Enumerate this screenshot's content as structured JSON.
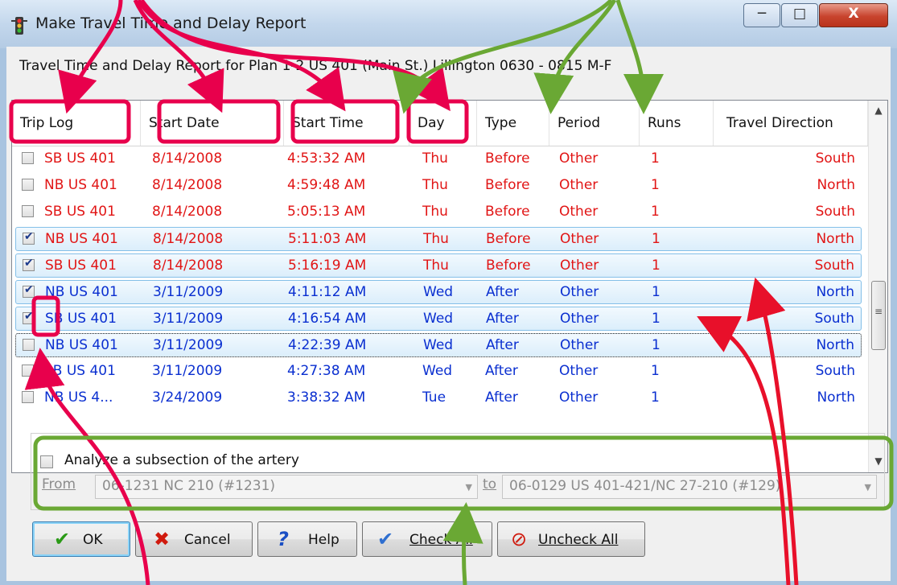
{
  "window": {
    "title": "Make Travel Time and Delay Report",
    "buttons": {
      "minimize": "─",
      "maximize": "□",
      "close": "X"
    }
  },
  "heading": "Travel Time and Delay Report for Plan 1-2 US 401 (Main St.) Lillington 0630 - 0815 M-F",
  "columns": [
    "Trip Log",
    "Start Date",
    "Start Time",
    "Day",
    "Type",
    "Period",
    "Runs",
    "Travel Direction"
  ],
  "rows": [
    {
      "checked": false,
      "selected": false,
      "focus": false,
      "color": "#e11515",
      "trip": "SB US 401",
      "date": "8/14/2008",
      "time": "4:53:32 AM",
      "day": "Thu",
      "type": "Before",
      "period": "Other",
      "runs": "1",
      "direction": "South"
    },
    {
      "checked": false,
      "selected": false,
      "focus": false,
      "color": "#e11515",
      "trip": "NB US 401",
      "date": "8/14/2008",
      "time": "4:59:48 AM",
      "day": "Thu",
      "type": "Before",
      "period": "Other",
      "runs": "1",
      "direction": "North"
    },
    {
      "checked": false,
      "selected": false,
      "focus": false,
      "color": "#e11515",
      "trip": "SB US 401",
      "date": "8/14/2008",
      "time": "5:05:13 AM",
      "day": "Thu",
      "type": "Before",
      "period": "Other",
      "runs": "1",
      "direction": "South"
    },
    {
      "checked": true,
      "selected": true,
      "focus": false,
      "color": "#e11515",
      "trip": "NB US 401",
      "date": "8/14/2008",
      "time": "5:11:03 AM",
      "day": "Thu",
      "type": "Before",
      "period": "Other",
      "runs": "1",
      "direction": "North"
    },
    {
      "checked": true,
      "selected": true,
      "focus": false,
      "color": "#e11515",
      "trip": "SB US 401",
      "date": "8/14/2008",
      "time": "5:16:19 AM",
      "day": "Thu",
      "type": "Before",
      "period": "Other",
      "runs": "1",
      "direction": "South"
    },
    {
      "checked": true,
      "selected": true,
      "focus": false,
      "color": "#0a2fd0",
      "trip": "NB US 401",
      "date": "3/11/2009",
      "time": "4:11:12 AM",
      "day": "Wed",
      "type": "After",
      "period": "Other",
      "runs": "1",
      "direction": "North"
    },
    {
      "checked": true,
      "selected": true,
      "focus": false,
      "color": "#0a2fd0",
      "trip": "SB US 401",
      "date": "3/11/2009",
      "time": "4:16:54 AM",
      "day": "Wed",
      "type": "After",
      "period": "Other",
      "runs": "1",
      "direction": "South"
    },
    {
      "checked": false,
      "selected": true,
      "focus": true,
      "color": "#0a2fd0",
      "trip": "NB US 401",
      "date": "3/11/2009",
      "time": "4:22:39 AM",
      "day": "Wed",
      "type": "After",
      "period": "Other",
      "runs": "1",
      "direction": "North"
    },
    {
      "checked": false,
      "selected": false,
      "focus": false,
      "color": "#0a2fd0",
      "trip": "SB US 401",
      "date": "3/11/2009",
      "time": "4:27:38 AM",
      "day": "Wed",
      "type": "After",
      "period": "Other",
      "runs": "1",
      "direction": "South"
    },
    {
      "checked": false,
      "selected": false,
      "focus": false,
      "color": "#0a2fd0",
      "trip": "NB US  4...",
      "date": "3/24/2009",
      "time": "3:38:32 AM",
      "day": "Tue",
      "type": "After",
      "period": "Other",
      "runs": "1",
      "direction": "North"
    }
  ],
  "subsection": {
    "checkbox_label": "Analyze a subsection of the artery",
    "checked": false,
    "from_label": "From",
    "from_value": "06-1231 NC 210 (#1231)",
    "to_label": "to",
    "to_value": "06-0129 US 401-421/NC 27-210 (#129)"
  },
  "buttons": {
    "ok": "OK",
    "cancel": "Cancel",
    "help": "Help",
    "check_all": "Check All",
    "uncheck_all": "Uncheck All"
  },
  "icons": {
    "title": "traffic-light-icon",
    "ok": "checkmark-icon",
    "cancel": "x-icon",
    "help": "question-icon",
    "check_all": "double-check-icon",
    "uncheck_all": "no-symbol-icon"
  },
  "colors": {
    "before_rows": "#e11515",
    "after_rows": "#0a2fd0",
    "annotation_red": "#e8004c",
    "annotation_green": "#6aa834",
    "annotation_arrow_red": "#e8102a"
  }
}
